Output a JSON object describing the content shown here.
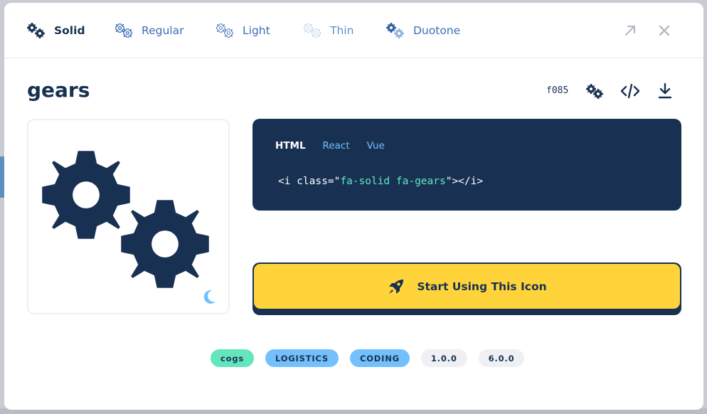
{
  "tabs": [
    {
      "label": "Solid",
      "icon": "gears-solid-icon",
      "active": true
    },
    {
      "label": "Regular",
      "icon": "gears-regular-icon"
    },
    {
      "label": "Light",
      "icon": "gears-light-icon"
    },
    {
      "label": "Thin",
      "icon": "gears-thin-icon"
    },
    {
      "label": "Duotone",
      "icon": "gears-duotone-icon"
    }
  ],
  "window_controls": {
    "open_icon": "arrow-up-right-icon",
    "close_icon": "close-icon"
  },
  "icon": {
    "name": "gears",
    "unicode": "f085"
  },
  "actions": [
    "gears-icon",
    "code-icon",
    "download-icon"
  ],
  "preview": {
    "icon": "gears-icon",
    "theme_toggle": "moon-icon"
  },
  "code": {
    "tabs": [
      "HTML",
      "React",
      "Vue"
    ],
    "active_tab": "HTML",
    "open": "<i class=\"",
    "class_value": "fa-solid fa-gears",
    "close": "\"></i>"
  },
  "cta": {
    "label": "Start Using This Icon",
    "icon": "rocket-icon"
  },
  "tags": [
    {
      "label": "cogs",
      "color": "#63e6be"
    },
    {
      "label": "LOGISTICS",
      "color": "#74c0fc"
    },
    {
      "label": "CODING",
      "color": "#74c0fc"
    },
    {
      "label": "1.0.0",
      "color": "#eef0f3"
    },
    {
      "label": "6.0.0",
      "color": "#eef0f3"
    }
  ],
  "colors": {
    "navy": "#183153",
    "yellow": "#ffd43b",
    "blue": "#3b6fb6",
    "sky": "#74c0fc",
    "mint": "#63e6be"
  }
}
